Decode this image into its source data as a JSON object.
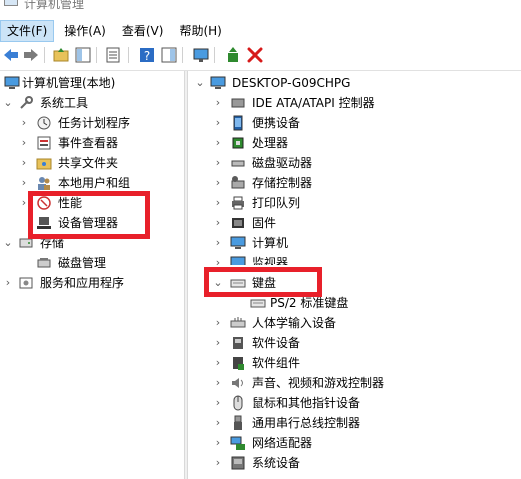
{
  "window": {
    "title": "计算机管理"
  },
  "menu": {
    "file": "文件(F)",
    "action": "操作(A)",
    "view": "查看(V)",
    "help": "帮助(H)"
  },
  "toolbar": {
    "icons": [
      "back-arrow-icon",
      "forward-arrow-icon",
      "up-folder-icon",
      "show-hide-tree-icon",
      "properties-icon",
      "help-icon",
      "action-pane-icon",
      "monitor-icon",
      "update-driver-icon",
      "uninstall-x-icon"
    ],
    "uninstall_color": "#d71a1a"
  },
  "left_tree": {
    "root": "计算机管理(本地)",
    "system_tools": "系统工具",
    "task_scheduler": "任务计划程序",
    "event_viewer": "事件查看器",
    "shared_folders": "共享文件夹",
    "local_users": "本地用户和组",
    "performance": "性能",
    "device_manager": "设备管理器",
    "storage": "存储",
    "disk_management": "磁盘管理",
    "services_apps": "服务和应用程序"
  },
  "right_tree": {
    "computer": "DESKTOP-G09CHPG",
    "ide": "IDE ATA/ATAPI 控制器",
    "portable": "便携设备",
    "processor": "处理器",
    "disk_drives": "磁盘驱动器",
    "storage_ctrl": "存储控制器",
    "print_queue": "打印队列",
    "firmware": "固件",
    "computer_node": "计算机",
    "monitors": "监视器",
    "keyboards": "键盘",
    "ps2_keyboard": "PS/2 标准键盘",
    "hid": "人体学输入设备",
    "software_devices": "软件设备",
    "software_components": "软件组件",
    "sound": "声音、视频和游戏控制器",
    "mice": "鼠标和其他指针设备",
    "usb": "通用串行总线控制器",
    "network": "网络适配器",
    "system_devices": "系统设备"
  },
  "highlight_color": "#e8202a"
}
